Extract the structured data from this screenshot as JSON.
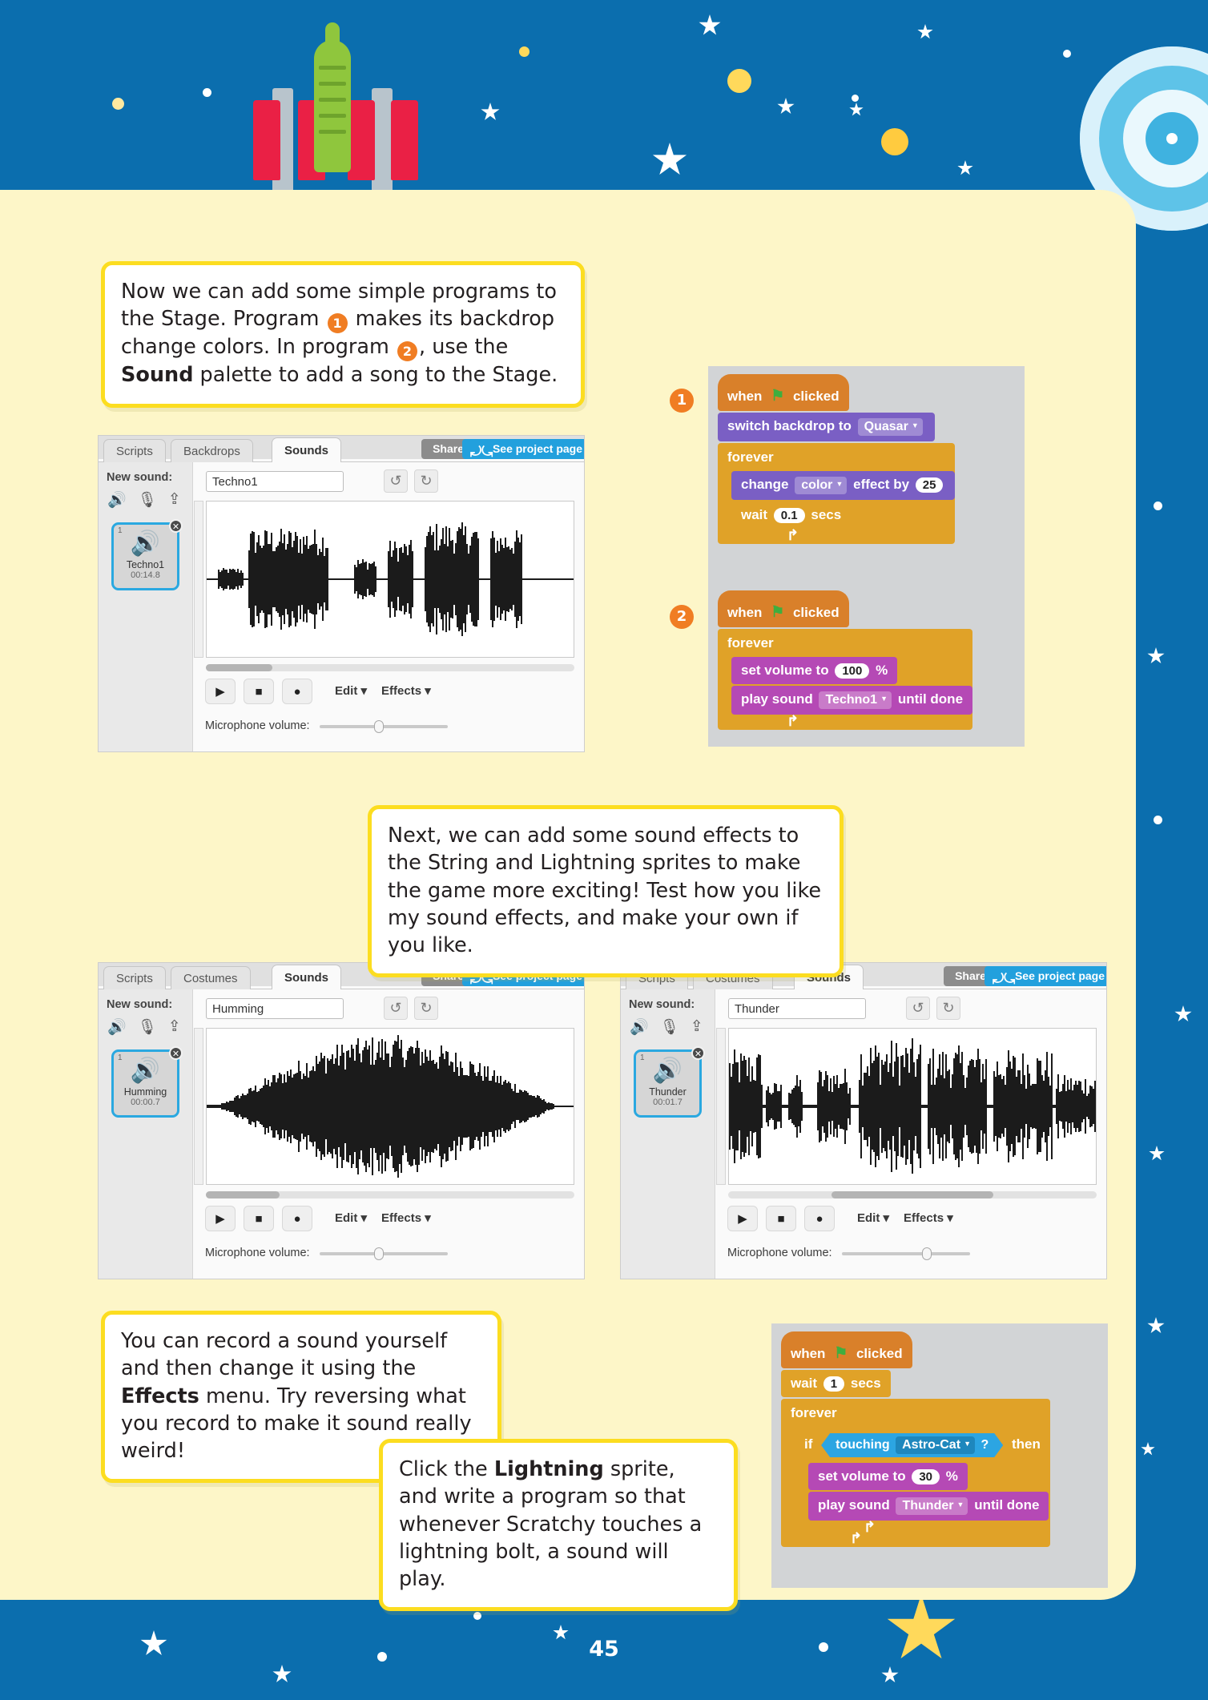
{
  "page": {
    "number": "45"
  },
  "callouts": [
    {
      "id": "callout-1",
      "parts": [
        {
          "t": "text",
          "v": "Now we can add some simple programs to the Stage. Program "
        },
        {
          "t": "badge",
          "v": "1"
        },
        {
          "t": "text",
          "v": " makes its backdrop change colors. In program "
        },
        {
          "t": "badge",
          "v": "2"
        },
        {
          "t": "text",
          "v": ", use the "
        },
        {
          "t": "bold",
          "v": "Sound"
        },
        {
          "t": "text",
          "v": " palette to add a song to the Stage."
        }
      ]
    },
    {
      "id": "callout-2",
      "parts": [
        {
          "t": "text",
          "v": "Next, we can add some sound effects to the String and Lightning sprites to make the game more exciting! Test how you like my sound effects, and make your own if you like."
        }
      ]
    },
    {
      "id": "callout-3",
      "parts": [
        {
          "t": "text",
          "v": "You can record a sound yourself and then change it using the "
        },
        {
          "t": "bold",
          "v": "Effects"
        },
        {
          "t": "text",
          "v": " menu. Try reversing what you record to make it sound really weird!"
        }
      ]
    },
    {
      "id": "callout-4",
      "parts": [
        {
          "t": "text",
          "v": "Click the "
        },
        {
          "t": "bold",
          "v": "Lightning"
        },
        {
          "t": "text",
          "v": " sprite, and write a program so that whenever Scratchy touches a lightning bolt, a sound will play."
        }
      ]
    }
  ],
  "editors": [
    {
      "id": "editor-1",
      "tabs": [
        {
          "label": "Scripts",
          "active": false
        },
        {
          "label": "Backdrops",
          "active": false
        },
        {
          "label": "Sounds",
          "active": true
        }
      ],
      "share_label": "Share",
      "see_project_label": "See project page",
      "see_project_icon": "refresh-arrows-icon",
      "new_sound_label": "New sound:",
      "new_sound_icons": [
        "speaker-library-icon",
        "microphone-icon",
        "upload-icon"
      ],
      "thumb": {
        "index": "1",
        "name": "Techno1",
        "duration": "00:14.8",
        "icon": "speaker-icon",
        "delete_icon": "close-icon"
      },
      "name_value": "Techno1",
      "undo_icon": "undo-icon",
      "redo_icon": "redo-icon",
      "play_icon": "play-icon",
      "stop_icon": "stop-icon",
      "record_icon": "record-icon",
      "edit_menu": "Edit ▾",
      "effects_menu": "Effects ▾",
      "mic_label": "Microphone volume:"
    },
    {
      "id": "editor-2",
      "tabs": [
        {
          "label": "Scripts",
          "active": false
        },
        {
          "label": "Costumes",
          "active": false
        },
        {
          "label": "Sounds",
          "active": true
        }
      ],
      "share_label": "Share",
      "see_project_label": "See project page",
      "see_project_icon": "refresh-arrows-icon",
      "new_sound_label": "New sound:",
      "new_sound_icons": [
        "speaker-library-icon",
        "microphone-icon",
        "upload-icon"
      ],
      "thumb": {
        "index": "1",
        "name": "Humming",
        "duration": "00:00.7",
        "icon": "speaker-icon",
        "delete_icon": "close-icon"
      },
      "name_value": "Humming",
      "undo_icon": "undo-icon",
      "redo_icon": "redo-icon",
      "play_icon": "play-icon",
      "stop_icon": "stop-icon",
      "record_icon": "record-icon",
      "edit_menu": "Edit ▾",
      "effects_menu": "Effects ▾",
      "mic_label": "Microphone volume:"
    },
    {
      "id": "editor-3",
      "tabs": [
        {
          "label": "Scripts",
          "active": false
        },
        {
          "label": "Costumes",
          "active": false
        },
        {
          "label": "Sounds",
          "active": true
        }
      ],
      "share_label": "Share",
      "see_project_label": "See project page",
      "see_project_icon": "refresh-arrows-icon",
      "new_sound_label": "New sound:",
      "new_sound_icons": [
        "speaker-library-icon",
        "microphone-icon",
        "upload-icon"
      ],
      "thumb": {
        "index": "1",
        "name": "Thunder",
        "duration": "00:01.7",
        "icon": "speaker-icon",
        "delete_icon": "close-icon"
      },
      "name_value": "Thunder",
      "undo_icon": "undo-icon",
      "redo_icon": "redo-icon",
      "play_icon": "play-icon",
      "stop_icon": "stop-icon",
      "record_icon": "record-icon",
      "edit_menu": "Edit ▾",
      "effects_menu": "Effects ▾",
      "mic_label": "Microphone volume:"
    }
  ],
  "scripts": {
    "one": {
      "badge": "1",
      "hat_when": "when",
      "hat_clicked": "clicked",
      "switch_backdrop": "switch backdrop to",
      "backdrop_value": "Quasar",
      "forever": "forever",
      "change": "change",
      "effect_value": "color",
      "effect_by": "effect by",
      "effect_amount": "25",
      "wait": "wait",
      "wait_secs": "0.1",
      "secs": "secs"
    },
    "two": {
      "badge": "2",
      "hat_when": "when",
      "hat_clicked": "clicked",
      "forever": "forever",
      "set_volume": "set volume to",
      "volume_value": "100",
      "percent": "%",
      "play_sound": "play sound",
      "sound_value": "Techno1",
      "until_done": "until done"
    },
    "three": {
      "hat_when": "when",
      "hat_clicked": "clicked",
      "wait": "wait",
      "wait_secs": "1",
      "secs": "secs",
      "forever": "forever",
      "if": "if",
      "touching": "touching",
      "touching_value": "Astro-Cat",
      "question": "?",
      "then": "then",
      "set_volume": "set volume to",
      "volume_value": "30",
      "percent": "%",
      "play_sound": "play sound",
      "sound_value": "Thunder",
      "until_done": "until done"
    }
  },
  "colors": {
    "space_blue": "#0b6eae",
    "panel_cream": "#fdf6c8",
    "callout_border": "#fcdd20",
    "badge_orange": "#f07d23",
    "block_events": "#d9802a",
    "block_control": "#e0a228",
    "block_looks": "#7a5fc4",
    "block_sound": "#b549b5",
    "block_sensing": "#2ca5e2",
    "scratch_blue": "#22a0dd"
  }
}
